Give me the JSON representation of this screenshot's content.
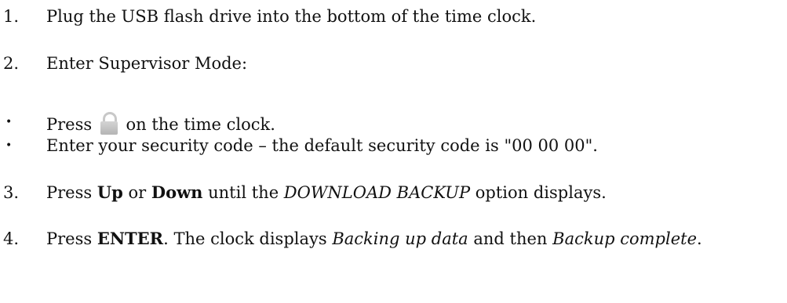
{
  "steps": {
    "step1": {
      "number": "1.",
      "text": "Plug the USB flash drive into the bottom of the time clock."
    },
    "step2": {
      "number": "2.",
      "text": "Enter Supervisor Mode:"
    },
    "bullet1": {
      "marker": "•",
      "prefix": "Press",
      "icon": "lock-icon",
      "suffix": "on the time clock."
    },
    "bullet2": {
      "marker": "•",
      "text": "Enter your security code – the default security code is \"00 00 00\"."
    },
    "step3": {
      "number": "3.",
      "t1": "Press ",
      "up": "Up",
      "t2": " or ",
      "down": "Down",
      "t3": " until the ",
      "option": "DOWNLOAD BACKUP",
      "t4": " option displays."
    },
    "step4": {
      "number": "4.",
      "t1": "Press ",
      "enter": "ENTER",
      "t2": ". The clock displays ",
      "msg1": "Backing up data",
      "t3": " and then ",
      "msg2": "Backup complete",
      "t4": "."
    }
  }
}
